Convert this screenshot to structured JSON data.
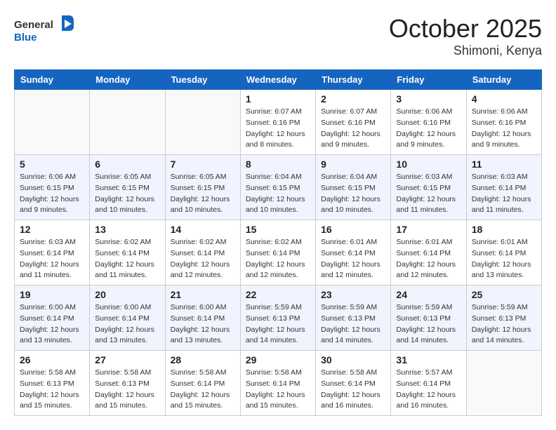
{
  "header": {
    "logo_general": "General",
    "logo_blue": "Blue",
    "month": "October 2025",
    "location": "Shimoni, Kenya"
  },
  "weekdays": [
    "Sunday",
    "Monday",
    "Tuesday",
    "Wednesday",
    "Thursday",
    "Friday",
    "Saturday"
  ],
  "weeks": [
    [
      {
        "day": "",
        "info": ""
      },
      {
        "day": "",
        "info": ""
      },
      {
        "day": "",
        "info": ""
      },
      {
        "day": "1",
        "info": "Sunrise: 6:07 AM\nSunset: 6:16 PM\nDaylight: 12 hours\nand 8 minutes."
      },
      {
        "day": "2",
        "info": "Sunrise: 6:07 AM\nSunset: 6:16 PM\nDaylight: 12 hours\nand 9 minutes."
      },
      {
        "day": "3",
        "info": "Sunrise: 6:06 AM\nSunset: 6:16 PM\nDaylight: 12 hours\nand 9 minutes."
      },
      {
        "day": "4",
        "info": "Sunrise: 6:06 AM\nSunset: 6:16 PM\nDaylight: 12 hours\nand 9 minutes."
      }
    ],
    [
      {
        "day": "5",
        "info": "Sunrise: 6:06 AM\nSunset: 6:15 PM\nDaylight: 12 hours\nand 9 minutes."
      },
      {
        "day": "6",
        "info": "Sunrise: 6:05 AM\nSunset: 6:15 PM\nDaylight: 12 hours\nand 10 minutes."
      },
      {
        "day": "7",
        "info": "Sunrise: 6:05 AM\nSunset: 6:15 PM\nDaylight: 12 hours\nand 10 minutes."
      },
      {
        "day": "8",
        "info": "Sunrise: 6:04 AM\nSunset: 6:15 PM\nDaylight: 12 hours\nand 10 minutes."
      },
      {
        "day": "9",
        "info": "Sunrise: 6:04 AM\nSunset: 6:15 PM\nDaylight: 12 hours\nand 10 minutes."
      },
      {
        "day": "10",
        "info": "Sunrise: 6:03 AM\nSunset: 6:15 PM\nDaylight: 12 hours\nand 11 minutes."
      },
      {
        "day": "11",
        "info": "Sunrise: 6:03 AM\nSunset: 6:14 PM\nDaylight: 12 hours\nand 11 minutes."
      }
    ],
    [
      {
        "day": "12",
        "info": "Sunrise: 6:03 AM\nSunset: 6:14 PM\nDaylight: 12 hours\nand 11 minutes."
      },
      {
        "day": "13",
        "info": "Sunrise: 6:02 AM\nSunset: 6:14 PM\nDaylight: 12 hours\nand 11 minutes."
      },
      {
        "day": "14",
        "info": "Sunrise: 6:02 AM\nSunset: 6:14 PM\nDaylight: 12 hours\nand 12 minutes."
      },
      {
        "day": "15",
        "info": "Sunrise: 6:02 AM\nSunset: 6:14 PM\nDaylight: 12 hours\nand 12 minutes."
      },
      {
        "day": "16",
        "info": "Sunrise: 6:01 AM\nSunset: 6:14 PM\nDaylight: 12 hours\nand 12 minutes."
      },
      {
        "day": "17",
        "info": "Sunrise: 6:01 AM\nSunset: 6:14 PM\nDaylight: 12 hours\nand 12 minutes."
      },
      {
        "day": "18",
        "info": "Sunrise: 6:01 AM\nSunset: 6:14 PM\nDaylight: 12 hours\nand 13 minutes."
      }
    ],
    [
      {
        "day": "19",
        "info": "Sunrise: 6:00 AM\nSunset: 6:14 PM\nDaylight: 12 hours\nand 13 minutes."
      },
      {
        "day": "20",
        "info": "Sunrise: 6:00 AM\nSunset: 6:14 PM\nDaylight: 12 hours\nand 13 minutes."
      },
      {
        "day": "21",
        "info": "Sunrise: 6:00 AM\nSunset: 6:14 PM\nDaylight: 12 hours\nand 13 minutes."
      },
      {
        "day": "22",
        "info": "Sunrise: 5:59 AM\nSunset: 6:13 PM\nDaylight: 12 hours\nand 14 minutes."
      },
      {
        "day": "23",
        "info": "Sunrise: 5:59 AM\nSunset: 6:13 PM\nDaylight: 12 hours\nand 14 minutes."
      },
      {
        "day": "24",
        "info": "Sunrise: 5:59 AM\nSunset: 6:13 PM\nDaylight: 12 hours\nand 14 minutes."
      },
      {
        "day": "25",
        "info": "Sunrise: 5:59 AM\nSunset: 6:13 PM\nDaylight: 12 hours\nand 14 minutes."
      }
    ],
    [
      {
        "day": "26",
        "info": "Sunrise: 5:58 AM\nSunset: 6:13 PM\nDaylight: 12 hours\nand 15 minutes."
      },
      {
        "day": "27",
        "info": "Sunrise: 5:58 AM\nSunset: 6:13 PM\nDaylight: 12 hours\nand 15 minutes."
      },
      {
        "day": "28",
        "info": "Sunrise: 5:58 AM\nSunset: 6:14 PM\nDaylight: 12 hours\nand 15 minutes."
      },
      {
        "day": "29",
        "info": "Sunrise: 5:58 AM\nSunset: 6:14 PM\nDaylight: 12 hours\nand 15 minutes."
      },
      {
        "day": "30",
        "info": "Sunrise: 5:58 AM\nSunset: 6:14 PM\nDaylight: 12 hours\nand 16 minutes."
      },
      {
        "day": "31",
        "info": "Sunrise: 5:57 AM\nSunset: 6:14 PM\nDaylight: 12 hours\nand 16 minutes."
      },
      {
        "day": "",
        "info": ""
      }
    ]
  ]
}
